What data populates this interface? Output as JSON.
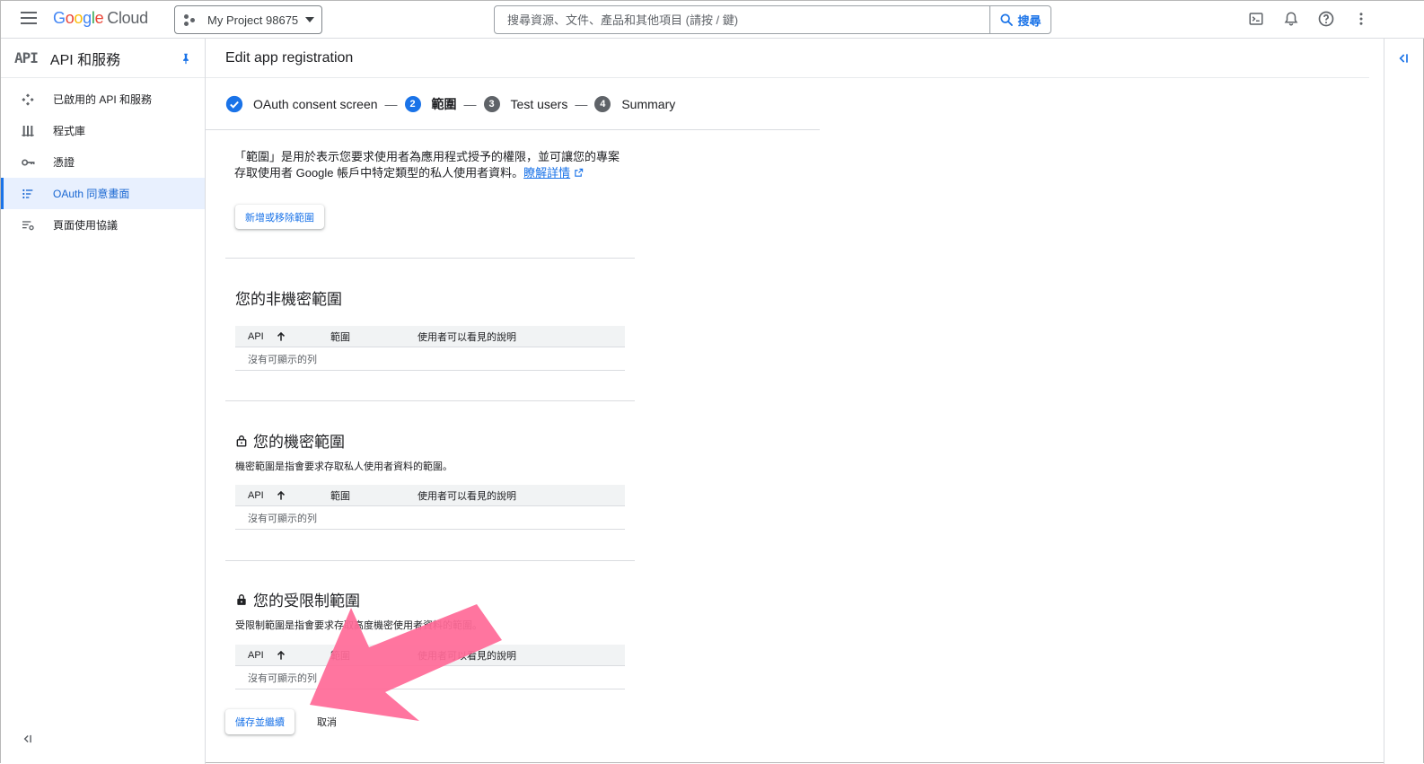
{
  "topbar": {
    "logo_google": [
      "G",
      "o",
      "o",
      "g",
      "l",
      "e"
    ],
    "logo_cloud": "Cloud",
    "project_name": "My Project 98675",
    "search_placeholder": "搜尋資源、文件、產品和其他項目 (請按 / 鍵)",
    "search_button": "搜尋",
    "icons": [
      "terminal-icon",
      "bell-icon",
      "help-icon",
      "more-vert-icon"
    ]
  },
  "sidebar": {
    "api_badge": "API",
    "title": "API 和服務",
    "items": [
      {
        "label": "已啟用的 API 和服務",
        "icon": "api-icon",
        "active": false
      },
      {
        "label": "程式庫",
        "icon": "library-icon",
        "active": false
      },
      {
        "label": "憑證",
        "icon": "key-icon",
        "active": false
      },
      {
        "label": "OAuth 同意畫面",
        "icon": "consent-icon",
        "active": true
      },
      {
        "label": "頁面使用協議",
        "icon": "settings-list-icon",
        "active": false
      }
    ],
    "collapse_label": "<|"
  },
  "main": {
    "page_title": "Edit app registration",
    "stepper": {
      "steps": [
        {
          "number": "",
          "label": "OAuth consent screen",
          "state": "done"
        },
        {
          "number": "2",
          "label": "範圍",
          "state": "current"
        },
        {
          "number": "3",
          "label": "Test users",
          "state": "todo"
        },
        {
          "number": "4",
          "label": "Summary",
          "state": "todo"
        }
      ],
      "separator": "—"
    },
    "intro_text": "「範圍」是用於表示您要求使用者為應用程式授予的權限，並可讓您的專案存取使用者 Google 帳戶中特定類型的私人使用者資料。",
    "learn_more": "瞭解詳情",
    "add_remove_button": "新增或移除範圍",
    "sections": [
      {
        "title": "您的非機密範圍",
        "desc": "",
        "icon": "",
        "headers": [
          "API",
          "範圍",
          "使用者可以看見的說明"
        ],
        "empty": "沒有可顯示的列"
      },
      {
        "title": "您的機密範圍",
        "desc": "機密範圍是指會要求存取私人使用者資料的範圍。",
        "icon": "lock-open-icon",
        "headers": [
          "API",
          "範圍",
          "使用者可以看見的說明"
        ],
        "empty": "沒有可顯示的列"
      },
      {
        "title": "您的受限制範圍",
        "desc": "受限制範圍是指會要求存取高度機密使用者資料的範圍。",
        "icon": "lock-icon",
        "headers": [
          "API",
          "範圍",
          "使用者可以看見的說明"
        ],
        "empty": "沒有可顯示的列"
      }
    ],
    "save_button": "儲存並繼續",
    "cancel_button": "取消"
  },
  "annotation": {
    "color": "#ff6b98"
  }
}
